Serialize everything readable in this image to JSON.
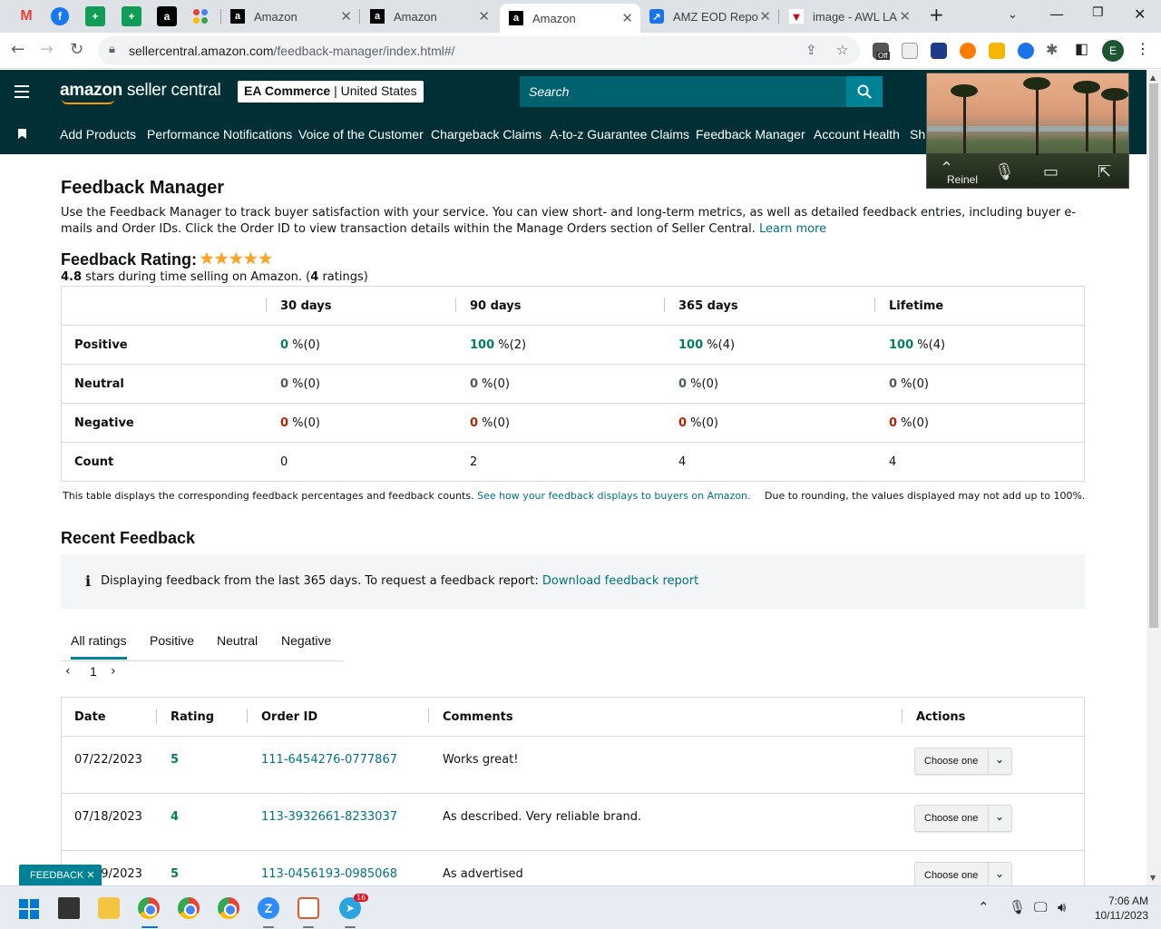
{
  "browser": {
    "tabs": [
      {
        "title": "Amazon",
        "active": false
      },
      {
        "title": "Amazon",
        "active": false
      },
      {
        "title": "Amazon",
        "active": true
      },
      {
        "title": "AMZ EOD Repo",
        "active": false
      },
      {
        "title": "image - AWL LA",
        "active": false
      }
    ],
    "url_host": "sellercentral.amazon.com",
    "url_path": "/feedback-manager/index.html#/",
    "profile_initial": "E",
    "ext_badge": "Off"
  },
  "header": {
    "logo_bold": "amazon",
    "logo_rest": " seller central",
    "store_name": "EA Commerce",
    "store_region": "United States",
    "search_placeholder": "Search"
  },
  "nav": [
    "Add Products",
    "Performance Notifications",
    "Voice of the Customer",
    "Chargeback Claims",
    "A-to-z Guarantee Claims",
    "Feedback Manager",
    "Account Health",
    "Sh"
  ],
  "video": {
    "participant": "Reinel"
  },
  "page": {
    "title": "Feedback Manager",
    "intro": "Use the Feedback Manager to track buyer satisfaction with your service. You can view short- and long-term metrics, as well as detailed feedback entries, including buyer e-mails and Order IDs. Click the Order ID to view transaction details within the Manage Orders section of Seller Central.",
    "learn_more": "Learn more",
    "rating_label": "Feedback Rating:",
    "stars": 5,
    "rating_value": "4.8",
    "rating_sub_mid": " stars during time selling on Amazon. (",
    "rating_count": "4",
    "rating_sub_end": " ratings)"
  },
  "metrics": {
    "columns": [
      "30 days",
      "90 days",
      "365 days",
      "Lifetime"
    ],
    "rows": [
      {
        "label": "Positive",
        "cells": [
          [
            "0",
            " %(0)"
          ],
          [
            "100",
            " %(2)"
          ],
          [
            "100",
            " %(4)"
          ],
          [
            "100",
            " %(4)"
          ]
        ]
      },
      {
        "label": "Neutral",
        "cells": [
          [
            "0",
            " %(0)"
          ],
          [
            "0",
            " %(0)"
          ],
          [
            "0",
            " %(0)"
          ],
          [
            "0",
            " %(0)"
          ]
        ]
      },
      {
        "label": "Negative",
        "cells": [
          [
            "0",
            " %(0)"
          ],
          [
            "0",
            " %(0)"
          ],
          [
            "0",
            " %(0)"
          ],
          [
            "0",
            " %(0)"
          ]
        ]
      },
      {
        "label": "Count",
        "cells": [
          [
            "0",
            ""
          ],
          [
            "2",
            ""
          ],
          [
            "4",
            ""
          ],
          [
            "4",
            ""
          ]
        ]
      }
    ],
    "note": "This table displays the corresponding feedback percentages and feedback counts.",
    "note_link": "See how your feedback displays to buyers on Amazon.",
    "rounding_note": "Due to rounding, the values displayed may not add up to 100%."
  },
  "recent": {
    "title": "Recent Feedback",
    "info_text": "Displaying feedback from the last 365 days. To request a feedback report:",
    "info_link": "Download feedback report",
    "tabs": [
      "All ratings",
      "Positive",
      "Neutral",
      "Negative"
    ],
    "page": "1",
    "columns": [
      "Date",
      "Rating",
      "Order ID",
      "Comments",
      "Actions"
    ],
    "rows": [
      {
        "date": "07/22/2023",
        "rating": "5",
        "order": "111-6454276-0777867",
        "comment": "Works great!",
        "action": "Choose one"
      },
      {
        "date": "07/18/2023",
        "rating": "4",
        "order": "113-3932661-8233037",
        "comment": "As described. Very reliable brand.",
        "action": "Choose one"
      },
      {
        "date": "07/19/2023",
        "rating": "5",
        "order": "113-0456193-0985068",
        "comment": "As advertised",
        "action": "Choose one"
      }
    ]
  },
  "feedback_tag": "FEEDBACK",
  "taskbar": {
    "time": "7:06 AM",
    "date": "10/11/2023",
    "telegram_badge": "16"
  },
  "colors": {
    "header": "#002f36",
    "search": "#00626f",
    "link": "#007185",
    "positive": "#067d62",
    "negative": "#b12704",
    "star": "#ffa41c"
  }
}
